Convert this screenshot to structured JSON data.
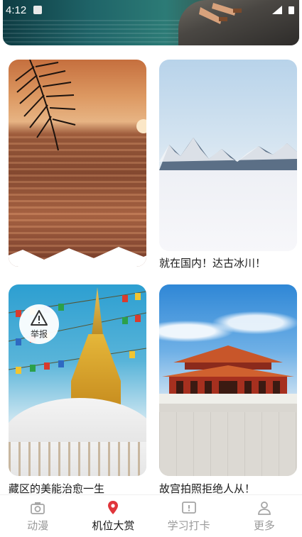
{
  "status_bar": {
    "time": "4:12"
  },
  "cards": [
    {
      "caption": ""
    },
    {
      "caption": "就在国内！达古冰川！"
    },
    {
      "caption": "藏区的美能治愈一生"
    },
    {
      "caption": "故宫拍照拒绝人从！"
    }
  ],
  "report_button": {
    "label": "举报"
  },
  "bottom_nav": {
    "items": [
      {
        "label": "动漫",
        "icon": "camera-icon",
        "active": false
      },
      {
        "label": "机位大赏",
        "icon": "location-pin-icon",
        "active": true
      },
      {
        "label": "学习打卡",
        "icon": "checkin-icon",
        "active": false
      },
      {
        "label": "更多",
        "icon": "person-icon",
        "active": false
      }
    ]
  },
  "colors": {
    "active_pin": "#e0353b",
    "inactive": "#9a9a9a",
    "active_text": "#1a1a1a"
  }
}
